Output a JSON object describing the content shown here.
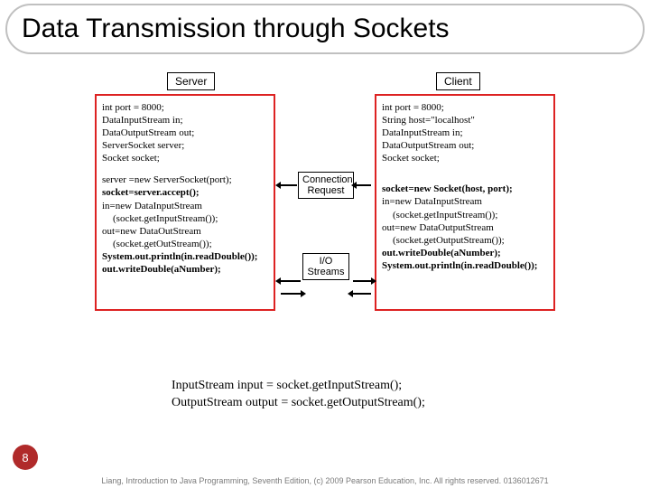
{
  "title": "Data Transmission through Sockets",
  "diagram": {
    "labels": {
      "server": "Server",
      "client": "Client",
      "connection": "Connection\nRequest",
      "io": "I/O\nStreams"
    },
    "server": [
      {
        "t": "int port = 8000;",
        "b": false
      },
      {
        "t": "DataInputStream in;",
        "b": false
      },
      {
        "t": "DataOutputStream out;",
        "b": false
      },
      {
        "t": "ServerSocket server;",
        "b": false
      },
      {
        "t": "Socket socket;",
        "b": false
      },
      {
        "t": "",
        "gap": true
      },
      {
        "t": "server =new ServerSocket(port);",
        "b": false
      },
      {
        "t": "socket=server.accept();",
        "b": true
      },
      {
        "t": "in=new DataInputStream",
        "b": false
      },
      {
        "t": "(socket.getInputStream());",
        "b": false,
        "ind": true
      },
      {
        "t": "out=new DataOutStream",
        "b": false
      },
      {
        "t": "(socket.getOutStream());",
        "b": false,
        "ind": true
      },
      {
        "t": "System.out.println(in.readDouble());",
        "b": true
      },
      {
        "t": "out.writeDouble(aNumber);",
        "b": true
      }
    ],
    "client": [
      {
        "t": "int port = 8000;",
        "b": false
      },
      {
        "t": "String host=\"localhost\"",
        "b": false
      },
      {
        "t": "DataInputStream in;",
        "b": false
      },
      {
        "t": "DataOutputStream out;",
        "b": false
      },
      {
        "t": "Socket socket;",
        "b": false
      },
      {
        "t": "",
        "gap": true
      },
      {
        "t": "",
        "gap": true
      },
      {
        "t": "socket=new Socket(host, port);",
        "b": true
      },
      {
        "t": "in=new DataInputStream",
        "b": false
      },
      {
        "t": "(socket.getInputStream());",
        "b": false,
        "ind": true
      },
      {
        "t": "out=new DataOutputStream",
        "b": false
      },
      {
        "t": "(socket.getOutputStream());",
        "b": false,
        "ind": true
      },
      {
        "t": "out.writeDouble(aNumber);",
        "b": true
      },
      {
        "t": "System.out.println(in.readDouble());",
        "b": true
      }
    ]
  },
  "snippet": {
    "line1": "InputStream input = socket.getInputStream();",
    "line2": "OutputStream output = socket.getOutputStream();"
  },
  "pagenum": "8",
  "footer": "Liang, Introduction to Java Programming, Seventh Edition, (c) 2009 Pearson Education, Inc. All rights reserved. 0136012671"
}
